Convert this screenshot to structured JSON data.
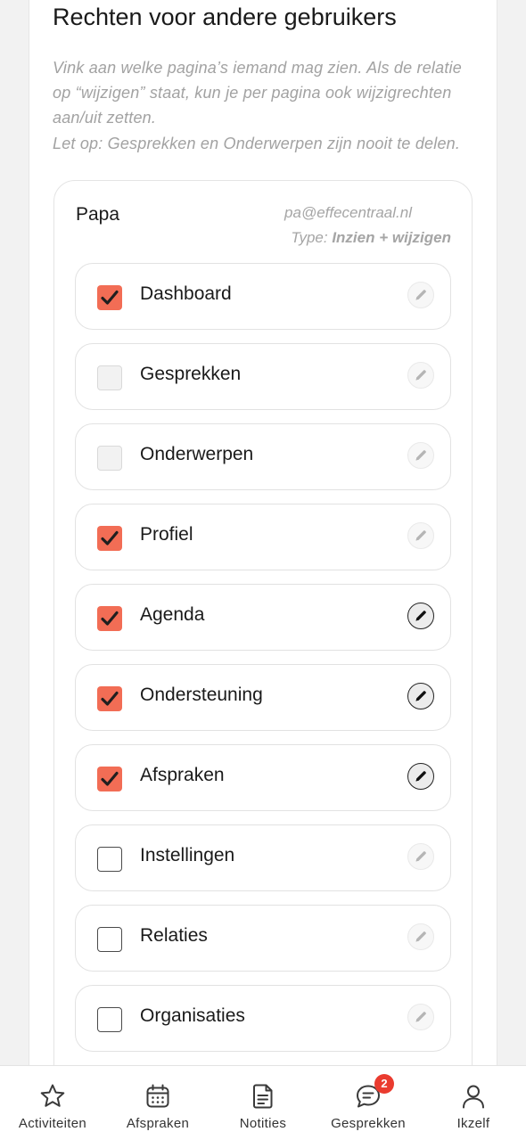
{
  "section": {
    "title": "Rechten voor andere gebruikers",
    "intro_line1": "Vink aan welke pagina’s iemand mag zien. Als de relatie op “wijzigen” staat, kun je per pagina ook wijzigrechten aan/uit zetten.",
    "intro_line2": "Let op: Gesprekken en Onderwerpen zijn nooit te delen."
  },
  "user": {
    "name": "Papa",
    "email": "pa@effecentraal.nl",
    "type_label": "Type: ",
    "type_value": "Inzien + wijzigen"
  },
  "pages": [
    {
      "label": "Dashboard",
      "checked": true,
      "disabled": false,
      "edit_active": false
    },
    {
      "label": "Gesprekken",
      "checked": false,
      "disabled": true,
      "edit_active": false
    },
    {
      "label": "Onderwerpen",
      "checked": false,
      "disabled": true,
      "edit_active": false
    },
    {
      "label": "Profiel",
      "checked": true,
      "disabled": false,
      "edit_active": false
    },
    {
      "label": "Agenda",
      "checked": true,
      "disabled": false,
      "edit_active": true
    },
    {
      "label": "Ondersteuning",
      "checked": true,
      "disabled": false,
      "edit_active": true
    },
    {
      "label": "Afspraken",
      "checked": true,
      "disabled": false,
      "edit_active": true
    },
    {
      "label": "Instellingen",
      "checked": false,
      "disabled": false,
      "edit_active": false
    },
    {
      "label": "Relaties",
      "checked": false,
      "disabled": false,
      "edit_active": false
    },
    {
      "label": "Organisaties",
      "checked": false,
      "disabled": false,
      "edit_active": false
    }
  ],
  "tabbar": {
    "tabs": [
      {
        "label": "Activiteiten",
        "icon": "star-icon"
      },
      {
        "label": "Afspraken",
        "icon": "calendar-icon"
      },
      {
        "label": "Notities",
        "icon": "document-icon"
      },
      {
        "label": "Gesprekken",
        "icon": "chat-icon"
      },
      {
        "label": "Ikzelf",
        "icon": "person-icon"
      }
    ],
    "badge_count": "2"
  },
  "colors": {
    "accent": "#f26d55",
    "badge": "#ea3b2f"
  }
}
